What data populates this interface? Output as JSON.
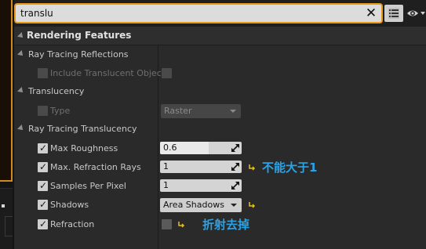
{
  "search": {
    "value": "translu",
    "clear_glyph": "✕"
  },
  "icons": {
    "clear": "close-icon",
    "view_options": "list-view-icon",
    "visibility": "eye-icon",
    "expand": "triangle-down-icon",
    "reset": "reset-to-default-arrow-icon"
  },
  "colors": {
    "focus": "#e89a1b",
    "annotation": "#29a3e6",
    "reset_arrow": "#e8c21b"
  },
  "category": {
    "label": "Rendering Features"
  },
  "sections": {
    "reflections": {
      "label": "Ray Tracing Reflections",
      "include_translucent": "Include Translucent Object",
      "include_translucent_checked": false
    },
    "translucency": {
      "label": "Translucency",
      "type_label": "Type",
      "type_value": "Raster"
    },
    "rt_translucency": {
      "label": "Ray Tracing Translucency",
      "max_roughness": {
        "label": "Max Roughness",
        "value": "0.6",
        "fill": 0.6
      },
      "max_refraction_rays": {
        "label": "Max. Refraction Rays",
        "value": "1"
      },
      "samples_per_pixel": {
        "label": "Samples Per Pixel",
        "value": "1"
      },
      "shadows": {
        "label": "Shadows",
        "value": "Area Shadows"
      },
      "refraction": {
        "label": "Refraction",
        "checked": false
      }
    }
  },
  "annotations": {
    "rays_note": "不能大于1",
    "refraction_note": "折射去掉"
  }
}
